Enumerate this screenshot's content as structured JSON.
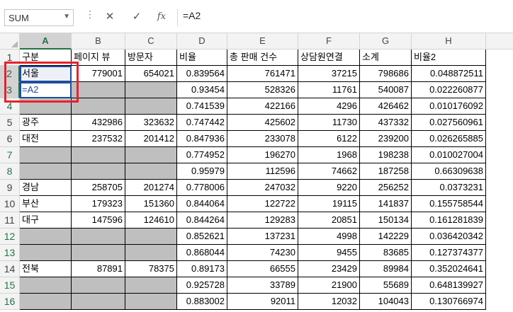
{
  "formula_bar": {
    "name_box": "SUM",
    "cancel_icon": "✕",
    "enter_icon": "✓",
    "function_icon": "fx",
    "formula": "=A2"
  },
  "columns": [
    "A",
    "B",
    "C",
    "D",
    "E",
    "F",
    "G",
    "H"
  ],
  "row_numbers": [
    "1",
    "2",
    "3",
    "4",
    "5",
    "6",
    "7",
    "8",
    "9",
    "10",
    "11",
    "12",
    "13",
    "14",
    "15",
    "16"
  ],
  "headers": [
    "구분",
    "페이지 뷰",
    "방문자",
    "비율",
    "총 판매 건수",
    "상담원연결",
    "소계",
    "비율2"
  ],
  "rows": [
    {
      "a": "서울",
      "b": "779001",
      "c": "654021",
      "d": "0.839564",
      "e": "761471",
      "f": "37215",
      "g": "798686",
      "h": "0.048872511"
    },
    {
      "a": "=A2",
      "b": "",
      "c": "",
      "d": "0.93454",
      "e": "528326",
      "f": "11761",
      "g": "540087",
      "h": "0.022260877"
    },
    {
      "a": "",
      "b": "",
      "c": "",
      "d": "0.741539",
      "e": "422166",
      "f": "4296",
      "g": "426462",
      "h": "0.010176092"
    },
    {
      "a": "광주",
      "b": "432986",
      "c": "323632",
      "d": "0.747442",
      "e": "425602",
      "f": "11730",
      "g": "437332",
      "h": "0.027560961"
    },
    {
      "a": "대전",
      "b": "237532",
      "c": "201412",
      "d": "0.847936",
      "e": "233078",
      "f": "6122",
      "g": "239200",
      "h": "0.026265885"
    },
    {
      "a": "",
      "b": "",
      "c": "",
      "d": "0.774952",
      "e": "196270",
      "f": "1968",
      "g": "198238",
      "h": "0.010027004"
    },
    {
      "a": "",
      "b": "",
      "c": "",
      "d": "0.95979",
      "e": "112596",
      "f": "74662",
      "g": "187258",
      "h": "0.66309638"
    },
    {
      "a": "경남",
      "b": "258705",
      "c": "201274",
      "d": "0.778006",
      "e": "247032",
      "f": "9220",
      "g": "256252",
      "h": "0.0373231"
    },
    {
      "a": "부산",
      "b": "179323",
      "c": "151360",
      "d": "0.844064",
      "e": "122722",
      "f": "19115",
      "g": "141837",
      "h": "0.155758544"
    },
    {
      "a": "대구",
      "b": "147596",
      "c": "124610",
      "d": "0.844264",
      "e": "129283",
      "f": "20851",
      "g": "150134",
      "h": "0.161281839"
    },
    {
      "a": "",
      "b": "",
      "c": "",
      "d": "0.852621",
      "e": "137231",
      "f": "4998",
      "g": "142229",
      "h": "0.036420342"
    },
    {
      "a": "",
      "b": "",
      "c": "",
      "d": "0.868044",
      "e": "74230",
      "f": "9455",
      "g": "83685",
      "h": "0.127374377"
    },
    {
      "a": "전북",
      "b": "87891",
      "c": "78375",
      "d": "0.89173",
      "e": "66555",
      "f": "23429",
      "g": "89984",
      "h": "0.352024641"
    },
    {
      "a": "",
      "b": "",
      "c": "",
      "d": "0.925728",
      "e": "33789",
      "f": "21900",
      "g": "55689",
      "h": "0.648139927"
    },
    {
      "a": "",
      "b": "",
      "c": "",
      "d": "0.883002",
      "e": "92011",
      "f": "12032",
      "g": "104043",
      "h": "0.130766974"
    }
  ],
  "colors": {
    "excel_green": "#217346",
    "highlight_red": "#e8222b",
    "grey_fill": "#bfbfbf",
    "reference_blue": "#1f4e9d"
  }
}
